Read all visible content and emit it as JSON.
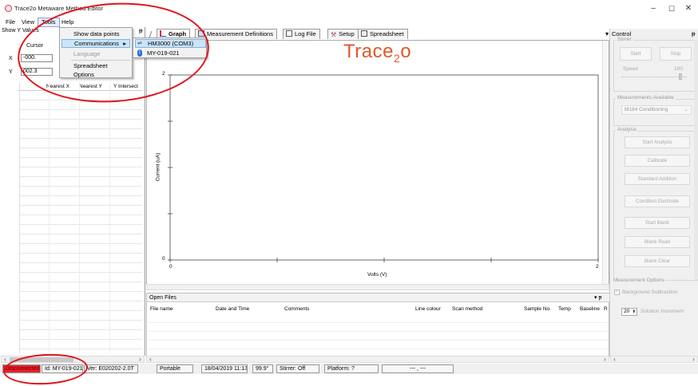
{
  "window": {
    "title": "Trace2o Metaware Method Editor",
    "minimize": "–",
    "maximize": "☐",
    "close": "✕"
  },
  "menubar": {
    "items": [
      "File",
      "View",
      "Tools",
      "Help"
    ]
  },
  "left_panel": {
    "header": "Show Y Values",
    "pin": "ᵽ",
    "cursor_label": "Cursor",
    "x_label": "X",
    "x_value": "-000.",
    "y_label": "Y",
    "y_value": "002.3",
    "columns": [
      "Nearest X",
      "Nearest Y",
      "Y Intersect"
    ]
  },
  "tools_menu": {
    "items": [
      {
        "label": "Show data points",
        "state": "normal"
      },
      {
        "label": "Communications",
        "state": "highlighted",
        "arrow": "▸"
      },
      {
        "label": "Language",
        "state": "disabled"
      },
      {
        "label": "Spreadsheet",
        "state": "normal"
      },
      {
        "label": "Options",
        "state": "normal"
      }
    ]
  },
  "communications_submenu": {
    "items": [
      {
        "label": "HM3000 (COM3)",
        "icon": "usb-icon"
      },
      {
        "label": "MY-019-021",
        "icon": "bluetooth-icon"
      }
    ]
  },
  "tabs": [
    {
      "label": "Graph",
      "icon": "graph-icon",
      "active": true
    },
    {
      "label": "Measurement Definitions",
      "icon": "table-icon",
      "active": false
    },
    {
      "label": "Log File",
      "icon": "document-icon",
      "active": false
    },
    {
      "label": "Setup",
      "icon": "tools-icon",
      "active": false
    },
    {
      "label": "Spreadsheet",
      "icon": "spreadsheet-icon",
      "active": false
    }
  ],
  "tab_dropdown_arrow": "▾",
  "graph": {
    "logo_text": "Trace",
    "logo_sub": "2",
    "logo_end": "o",
    "xlabel": "Volts (V)",
    "ylabel": "Current (uA)",
    "xticks": [
      "0",
      "2"
    ],
    "yticks": [
      "0",
      "2"
    ]
  },
  "chart_data": {
    "type": "line",
    "series": [],
    "xlabel": "Volts (V)",
    "ylabel": "Current (uA)",
    "xlim": [
      0,
      2
    ],
    "ylim": [
      0,
      2
    ],
    "grid": false
  },
  "open_files": {
    "title": "Open Files",
    "pin": "▾ ᵽ",
    "columns": [
      "File name",
      "Date and Time",
      "Comments",
      "Line colour",
      "Scan method",
      "Sample No.",
      "Temp",
      "Baseline",
      "R"
    ]
  },
  "control": {
    "title": "Control",
    "stirrer_label": "Stirrer",
    "start_label": "Start",
    "stop_label": "Stop",
    "speed_label": "Speed",
    "speed_value": "100",
    "measurements_label": "Measurements Available",
    "measurement_selected": "M184 Conditioning",
    "analysis_label": "Analysis",
    "analysis_buttons": [
      "Start Analysis",
      "Calibrate",
      "Standard Addition",
      "Condition Electrode",
      "Start Blank",
      "Blank Read",
      "Blank Clear"
    ],
    "options_label": "Measurement Options",
    "background_subtraction": "Background Subtraction",
    "solution_increment_value": "20",
    "solution_increment_label": "Solution Increment"
  },
  "status_bar": {
    "connection": "Disconnected",
    "id": "Id: MY-019-021",
    "ver": "Ver: E020202-2.0T",
    "mode": "Portable",
    "datetime": "18/04/2019 11:13",
    "temp": "99.9°",
    "stirrer": "Stirrer: Off",
    "platform": "Platform: ?",
    "extra": "--- , ---"
  },
  "colors": {
    "disconnected_bg": "#e8202a",
    "annotation": "#e0141b",
    "logo": "#e0582a",
    "highlight": "#cce4f7"
  }
}
